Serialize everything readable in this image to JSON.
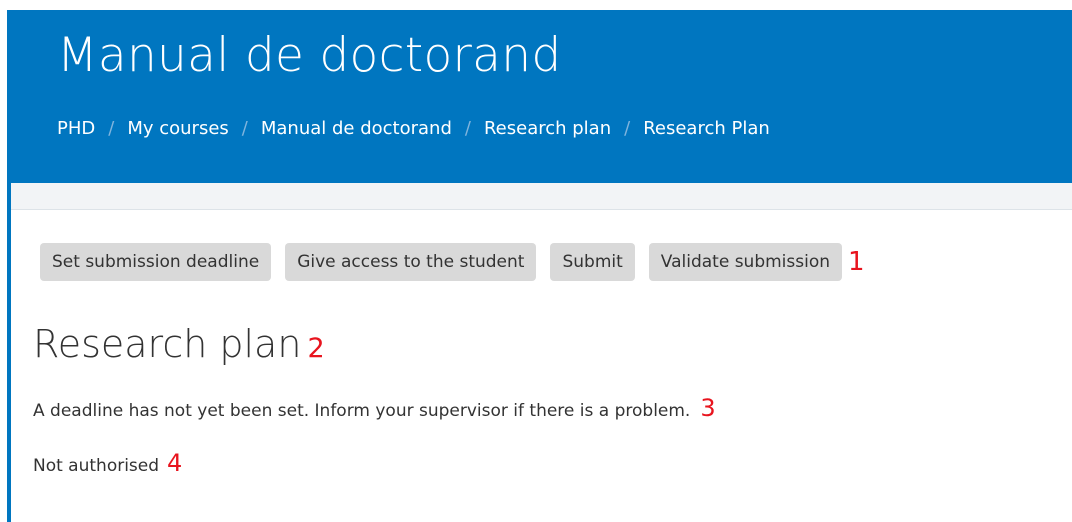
{
  "header": {
    "title": "Manual de doctorand",
    "breadcrumb": [
      {
        "label": "PHD"
      },
      {
        "label": "My courses"
      },
      {
        "label": "Manual de doctorand"
      },
      {
        "label": "Research plan"
      },
      {
        "label": "Research Plan"
      }
    ],
    "separator": "/"
  },
  "toolbar": {
    "buttons": [
      {
        "label": "Set submission deadline"
      },
      {
        "label": "Give access to the student"
      },
      {
        "label": "Submit"
      },
      {
        "label": "Validate submission"
      }
    ],
    "annotation": "1"
  },
  "main": {
    "heading": "Research plan",
    "heading_annotation": "2",
    "deadline_message": "A deadline has not yet been set. Inform your supervisor if there is a problem.",
    "deadline_annotation": "3",
    "status_message": "Not authorised",
    "status_annotation": "4"
  },
  "colors": {
    "header_bg": "#0076c0",
    "button_bg": "#d9d9d9",
    "annotation": "#e8141e"
  }
}
